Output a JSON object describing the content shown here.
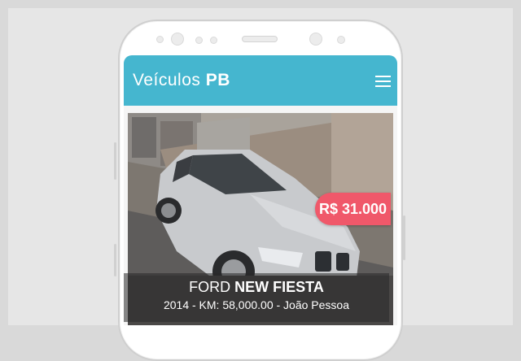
{
  "app": {
    "title_light": "Veículos",
    "title_bold": "PB"
  },
  "icons": {
    "menu": "hamburger-menu-icon"
  },
  "colors": {
    "appbar": "#45b6cf",
    "price_badge": "#f0586a"
  },
  "listing": {
    "price": "R$ 31.000",
    "make": "FORD",
    "model": "NEW FIESTA",
    "details": "2014 - KM: 58,000.00 - João Pessoa"
  }
}
